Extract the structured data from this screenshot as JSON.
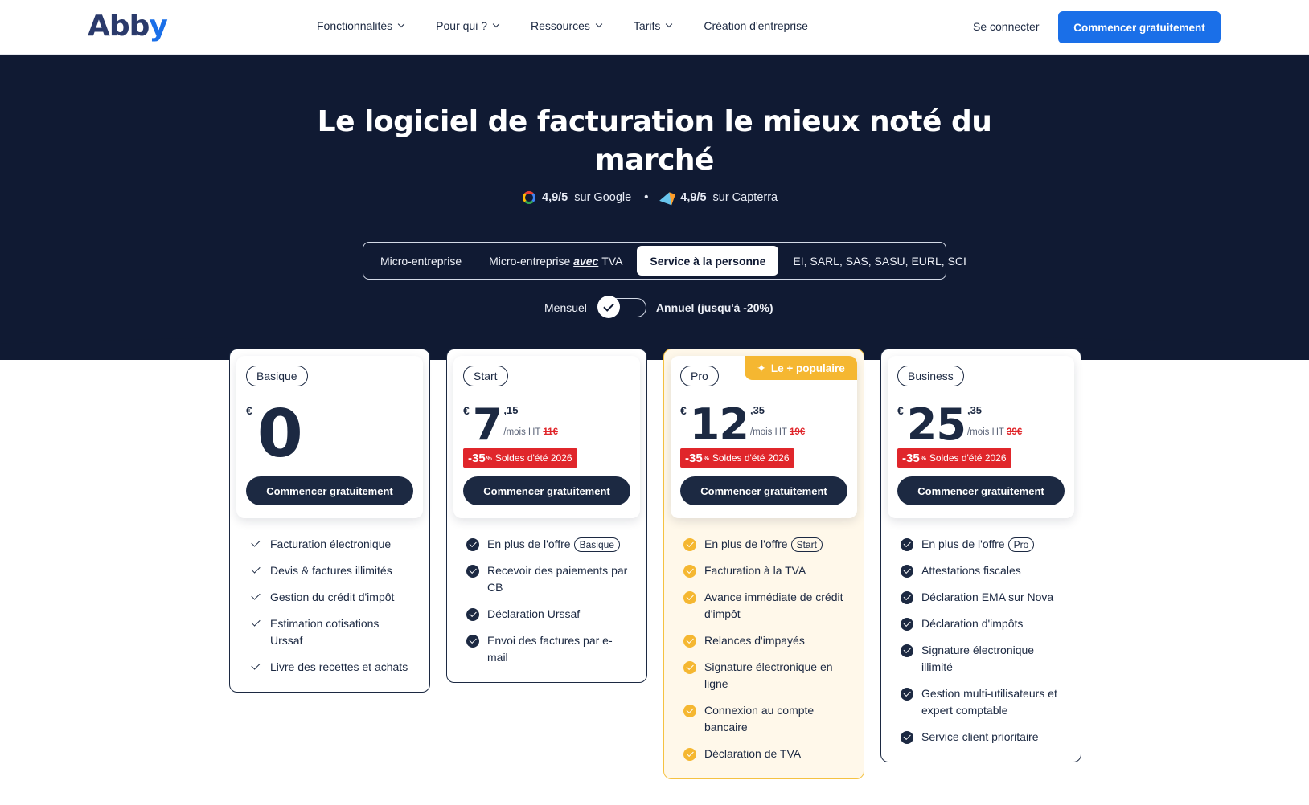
{
  "header": {
    "logo": "Abby",
    "nav": [
      "Fonctionnalités",
      "Pour qui ?",
      "Ressources",
      "Tarifs",
      "Création d'entreprise"
    ],
    "login": "Se connecter",
    "cta": "Commencer gratuitement"
  },
  "hero": {
    "title": "Le logiciel de facturation le mieux noté du marché",
    "ratings": [
      {
        "score": "4,9/5",
        "source": "sur Google",
        "icon": "google-icon"
      },
      {
        "score": "4,9/5",
        "source": "sur Capterra",
        "icon": "capterra-icon"
      }
    ],
    "separator": "•",
    "tabs": {
      "t1": "Micro-entreprise",
      "t2_prefix": "Micro-entreprise",
      "t2_em": "avec",
      "t2_suffix": "TVA",
      "t3": "Service à la personne",
      "t4": "EI, SARL, SAS, SASU, EURL, SCI",
      "active": "Service à la personne"
    },
    "billing": {
      "monthly": "Mensuel",
      "annual": "Annuel (jusqu'à -20%)",
      "selected": "Mensuel"
    }
  },
  "plans": [
    {
      "name": "Basique",
      "currency": "€",
      "price_int": "0",
      "cta": "Commencer gratuitement",
      "features": [
        "Facturation électronique",
        "Devis & factures illimités",
        "Gestion du crédit d'impôt",
        "Estimation cotisations Urssaf",
        "Livre des recettes et achats"
      ]
    },
    {
      "name": "Start",
      "currency": "€",
      "price_int": "7",
      "price_dec": ",15",
      "unit": "/mois HT",
      "old_price": "11€",
      "discount": "-35",
      "discount_pct": "%",
      "sale_label": "Soldes d'été 2026",
      "cta": "Commencer gratuitement",
      "plus_prefix": "En plus de l'offre",
      "plus_plan": "Basique",
      "features": [
        "Recevoir des paiements par CB",
        "Déclaration Urssaf",
        "Envoi des factures par e-mail"
      ]
    },
    {
      "name": "Pro",
      "badge": "Le + populaire",
      "currency": "€",
      "price_int": "12",
      "price_dec": ",35",
      "unit": "/mois HT",
      "old_price": "19€",
      "discount": "-35",
      "discount_pct": "%",
      "sale_label": "Soldes d'été 2026",
      "cta": "Commencer gratuitement",
      "plus_prefix": "En plus de l'offre",
      "plus_plan": "Start",
      "features": [
        "Facturation à la TVA",
        "Avance immédiate de crédit d'impôt",
        "Relances d'impayés",
        "Signature électronique en ligne",
        "Connexion au compte bancaire",
        "Déclaration de TVA"
      ]
    },
    {
      "name": "Business",
      "currency": "€",
      "price_int": "25",
      "price_dec": ",35",
      "unit": "/mois HT",
      "old_price": "39€",
      "discount": "-35",
      "discount_pct": "%",
      "sale_label": "Soldes d'été 2026",
      "cta": "Commencer gratuitement",
      "plus_prefix": "En plus de l'offre",
      "plus_plan": "Pro",
      "features": [
        "Attestations fiscales",
        "Déclaration EMA sur Nova",
        "Déclaration d'impôts",
        "Signature électronique illimité",
        "Gestion multi-utilisateurs et expert comptable",
        "Service client prioritaire"
      ]
    }
  ],
  "colors": {
    "navy": "#101a33",
    "brand_blue": "#1a6fe8",
    "dark": "#1c2942",
    "gold": "#f5b731",
    "sale_red": "#e0262b"
  }
}
